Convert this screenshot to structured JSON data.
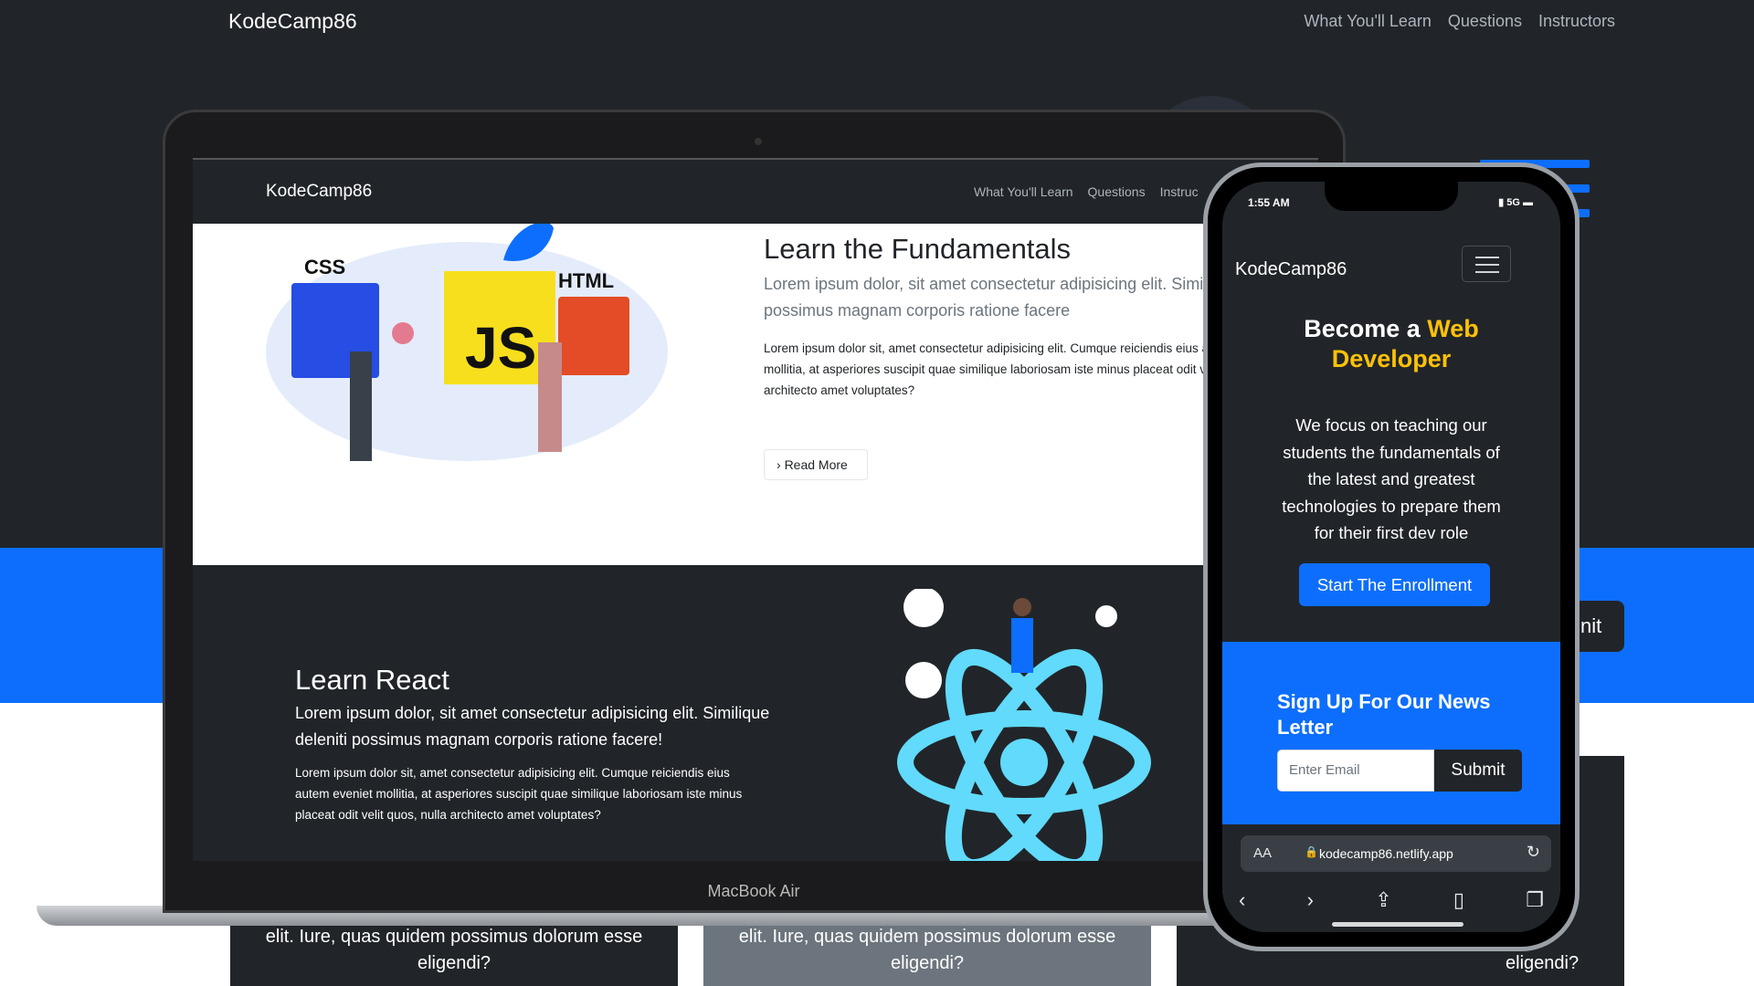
{
  "site_nav": {
    "brand": "KodeCamp86",
    "links": [
      "What You'll Learn",
      "Questions",
      "Instructors"
    ]
  },
  "background_cards": [
    {
      "text": "elit. Iure, quas quidem possimus dolorum esse eligendi?"
    },
    {
      "text": "elit. Iure, quas quidem possimus dolorum esse eligendi?"
    },
    {
      "text": "ng se eligendi?"
    }
  ],
  "background_submit_partial": "nit",
  "laptop": {
    "label": "MacBook Air",
    "nav": {
      "brand": "KodeCamp86",
      "links": [
        "What You'll Learn",
        "Questions",
        "Instruc"
      ]
    },
    "fundamentals": {
      "title": "Learn the Fundamentals",
      "lead": "Lorem ipsum dolor, sit amet consectetur adipisicing elit. Similique deleniti possimus magnam corporis ratione facere",
      "body": "Lorem ipsum dolor sit, amet consectetur adipisicing elit. Cumque reiciendis eius autem eveniet mollitia, at asperiores suscipit quae similique laboriosam iste minus placeat odit velit quos, nulla architecto amet voluptates?",
      "button": "Read More",
      "badges": [
        "CSS",
        "JS",
        "HTML"
      ]
    },
    "react": {
      "title": "Learn React",
      "lead": "Lorem ipsum dolor, sit amet consectetur adipisicing elit. Similique deleniti possimus magnam corporis ratione facere!",
      "body": "Lorem ipsum dolor sit, amet consectetur adipisicing elit. Cumque reiciendis eius autem eveniet mollitia, at asperiores suscipit quae similique laboriosam iste minus placeat odit velit quos, nulla architecto amet voluptates?"
    }
  },
  "phone": {
    "time": "1:55 AM",
    "status": "5G",
    "brand": "KodeCamp86",
    "hero_plain": "Become a ",
    "hero_accent": "Web Developer",
    "hero_text": "We focus on teaching our students the fundamentals of the latest and greatest technologies to prepare them for their first dev role",
    "cta": "Start The Enrollment",
    "newsletter_title": "Sign Up For Our News Letter",
    "email_placeholder": "Enter Email",
    "submit": "Submit",
    "browser": {
      "aa": "AA",
      "url": "kodecamp86.netlify.app"
    }
  },
  "colors": {
    "dark": "#212529",
    "primary": "#0d6efd",
    "accent": "#ffc107"
  }
}
